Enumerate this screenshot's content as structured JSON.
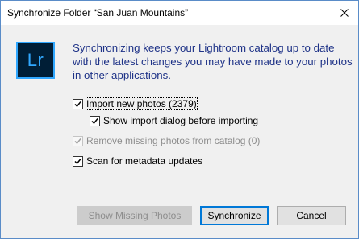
{
  "window": {
    "title": "Synchronize Folder “San Juan Mountains”"
  },
  "logo": {
    "text": "Lr"
  },
  "message": {
    "line1": "Synchronizing keeps your Lightroom catalog up to date",
    "line2": "with the latest changes you may have made to your photos",
    "line3": "in other applications."
  },
  "options": {
    "import_new": {
      "label": "Import new photos (2379)",
      "checked": true
    },
    "show_import_dialog": {
      "label": "Show import dialog before importing",
      "checked": true
    },
    "remove_missing": {
      "label": "Remove missing photos from catalog (0)",
      "checked": true,
      "disabled": true
    },
    "scan_metadata": {
      "label": "Scan for metadata updates",
      "checked": true
    }
  },
  "buttons": {
    "show_missing": "Show Missing Photos",
    "synchronize": "Synchronize",
    "cancel": "Cancel"
  },
  "colors": {
    "message_text": "#1e3287",
    "logo_bg": "#001e36",
    "logo_accent": "#31a8ff",
    "default_button_border": "#0078d7"
  }
}
